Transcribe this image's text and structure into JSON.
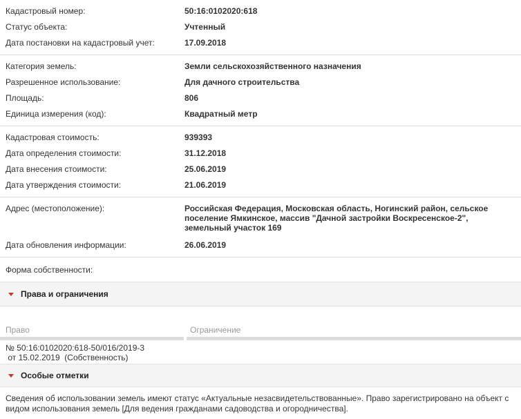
{
  "main_info": [
    {
      "label": "Кадастровый номер:",
      "value": "50:16:0102020:618"
    },
    {
      "label": "Статус объекта:",
      "value": "Учтенный"
    },
    {
      "label": "Дата постановки на кадастровый учет:",
      "value": "17.09.2018"
    }
  ],
  "land_info": [
    {
      "label": "Категория земель:",
      "value": "Земли сельскохозяйственного назначения"
    },
    {
      "label": "Разрешенное использование:",
      "value": "Для дачного строительства"
    },
    {
      "label": "Площадь:",
      "value": "806"
    },
    {
      "label": "Единица измерения (код):",
      "value": "Квадратный метр"
    }
  ],
  "cost_info": [
    {
      "label": "Кадастровая стоимость:",
      "value": "939393"
    },
    {
      "label": "Дата определения стоимости:",
      "value": "31.12.2018"
    },
    {
      "label": "Дата внесения стоимости:",
      "value": "25.06.2019"
    },
    {
      "label": "Дата утверждения стоимости:",
      "value": "21.06.2019"
    }
  ],
  "address_info": {
    "address_label": "Адрес (местоположение):",
    "address_value": "Российская Федерация, Московская область, Ногинский район, сельское поселение Ямкинское, массив \"Дачной застройки Воскресенское-2\", земельный участок 169",
    "update_label": "Дата обновления информации:",
    "update_value": "26.06.2019"
  },
  "ownership_label": "Форма собственности:",
  "rights_section": {
    "title": "Права и ограничения",
    "col_right": "Право",
    "col_restriction": "Ограничение",
    "row_right_line1": "№ 50:16:0102020:618-50/016/2019-3",
    "row_right_line2": " от 15.02.2019  (Собственность)"
  },
  "special_section": {
    "title": "Особые отметки",
    "text": "Сведения об использовании земель имеют статус «Актуальные незасвидетельствованные». Право зарегистрировано на объект с видом использования земель [Для ведения гражданами садоводства и огородничества]."
  },
  "colors": {
    "accent_triangle": "#c0392b",
    "section_bg": "#f4f4f4",
    "header_text": "#999999"
  },
  "icons": [
    "triangle-down-icon"
  ]
}
